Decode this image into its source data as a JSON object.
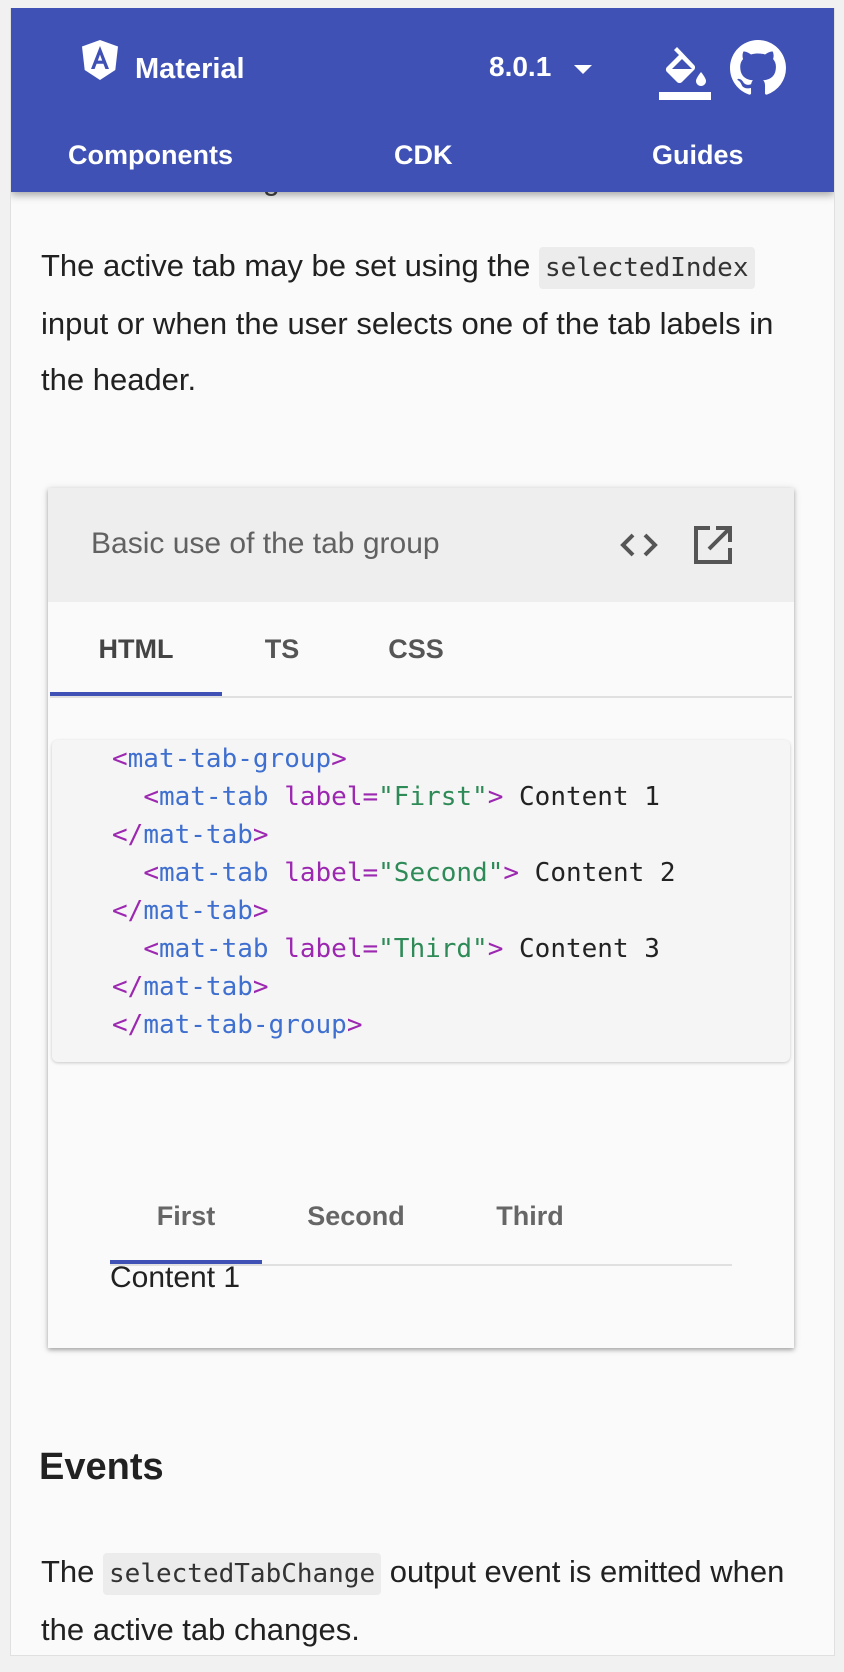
{
  "toolbar": {
    "brand": "Material",
    "version": "8.0.1",
    "nav": [
      "Components",
      "CDK",
      "Guides"
    ]
  },
  "content": {
    "faded_prev_text": "g",
    "para1": {
      "pre": "The active tab may be set using the ",
      "code": "selectedIndex",
      "post": " input or when the user selects one of the tab labels in the header."
    },
    "example": {
      "title": "Basic use of the tab group",
      "source_tabs": [
        "HTML",
        "TS",
        "CSS"
      ],
      "selected_source_tab": "HTML",
      "code_lines": [
        "<mat-tab-group>",
        "  <mat-tab label=\"First\"> Content 1",
        "</mat-tab>",
        "  <mat-tab label=\"Second\"> Content 2",
        "</mat-tab>",
        "  <mat-tab label=\"Third\"> Content 3",
        "</mat-tab>",
        "</mat-tab-group>"
      ],
      "demo_tabs": [
        "First",
        "Second",
        "Third"
      ],
      "selected_demo_tab": "First",
      "demo_content": "Content 1"
    },
    "events_heading": "Events",
    "para2": {
      "pre": "The ",
      "code": "selectedTabChange",
      "post": " output event is emitted when the active tab changes."
    }
  },
  "icons": {
    "logo": "angular-logo-icon",
    "version_dropdown": "arrow-drop-down-icon",
    "theme": "format-color-fill-icon",
    "github": "github-icon",
    "view_source": "code-icon",
    "open_external": "open-in-new-icon"
  },
  "colors": {
    "primary": "#3f51b5",
    "background": "#fafafa",
    "card_header": "#eeeeee"
  }
}
